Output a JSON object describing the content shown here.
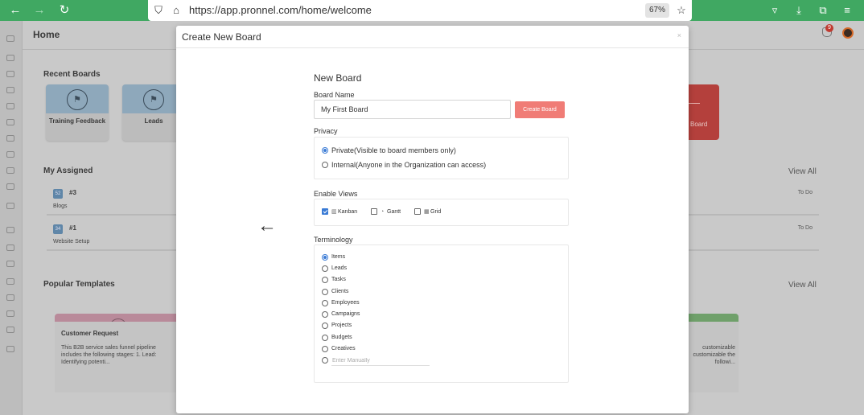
{
  "browser": {
    "url": "https://app.pronnel.com/home/welcome",
    "zoom": "67%"
  },
  "app": {
    "header_title": "Home",
    "notification_count": "9",
    "recent_boards_title": "Recent Boards",
    "recent_boards": [
      {
        "label": "Training Feedback"
      },
      {
        "label": "Leads"
      }
    ],
    "add_board_label": "Board",
    "my_assigned_title": "My Assigned",
    "view_all_label": "View All",
    "assigned_items": [
      {
        "tag": "52",
        "id": "#3",
        "name": "Blogs",
        "status": "To Do"
      },
      {
        "tag": "34",
        "id": "#1",
        "name": "Website Setup",
        "status": "To Do"
      }
    ],
    "popular_templates_title": "Popular Templates",
    "template_left": {
      "title": "Customer Request",
      "description": "This B2B service sales funnel pipeline includes the following stages: 1. Lead: Identifying potenti..."
    },
    "template_right_fragment": "customizable customizable the followi..."
  },
  "modal": {
    "title": "Create New Board",
    "close_label": "×",
    "heading": "New Board",
    "board_name_label": "Board Name",
    "board_name_value": "My First Board",
    "create_button": "Create Board",
    "privacy_label": "Privacy",
    "privacy_options": [
      {
        "label": "Private(Visible to board members only)",
        "selected": true
      },
      {
        "label": "Internal(Anyone in the Organization can access)",
        "selected": false
      }
    ],
    "enable_views_label": "Enable Views",
    "views": [
      {
        "label": "Kanban",
        "checked": true
      },
      {
        "label": "Gantt",
        "checked": false
      },
      {
        "label": "Grid",
        "checked": false
      }
    ],
    "terminology_label": "Terminology",
    "terminology_options": [
      {
        "label": "Items",
        "selected": true
      },
      {
        "label": "Leads",
        "selected": false
      },
      {
        "label": "Tasks",
        "selected": false
      },
      {
        "label": "Clients",
        "selected": false
      },
      {
        "label": "Employees",
        "selected": false
      },
      {
        "label": "Campaigns",
        "selected": false
      },
      {
        "label": "Projects",
        "selected": false
      },
      {
        "label": "Budgets",
        "selected": false
      },
      {
        "label": "Creatives",
        "selected": false
      }
    ],
    "manual_placeholder": "Enter Manually"
  },
  "colors": {
    "browser_bar": "#40a862",
    "accent_blue": "#3a7bd5",
    "create_button": "#f07c76"
  }
}
